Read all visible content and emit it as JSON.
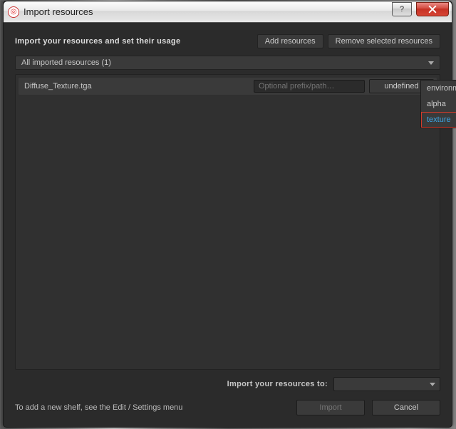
{
  "window": {
    "title": "Import resources"
  },
  "header": {
    "instruction": "Import your resources and set their usage",
    "add_btn": "Add resources",
    "remove_btn": "Remove selected resources"
  },
  "filter": {
    "label": "All imported resources (1)"
  },
  "rows": [
    {
      "name": "Diffuse_Texture.tga",
      "prefix_placeholder": "Optional prefix/path…",
      "usage": "undefined"
    }
  ],
  "dropdown": {
    "items": [
      "environment",
      "alpha",
      "texture"
    ],
    "highlighted": "texture"
  },
  "destination": {
    "label": "Import your resources to:",
    "value": ""
  },
  "footer": {
    "hint": "To add a new shelf, see the Edit / Settings menu",
    "import_btn": "Import",
    "cancel_btn": "Cancel"
  },
  "colors": {
    "accent": "#3aa8e8",
    "highlight_border": "#d43a2a",
    "close_btn": "#d24a3e"
  }
}
